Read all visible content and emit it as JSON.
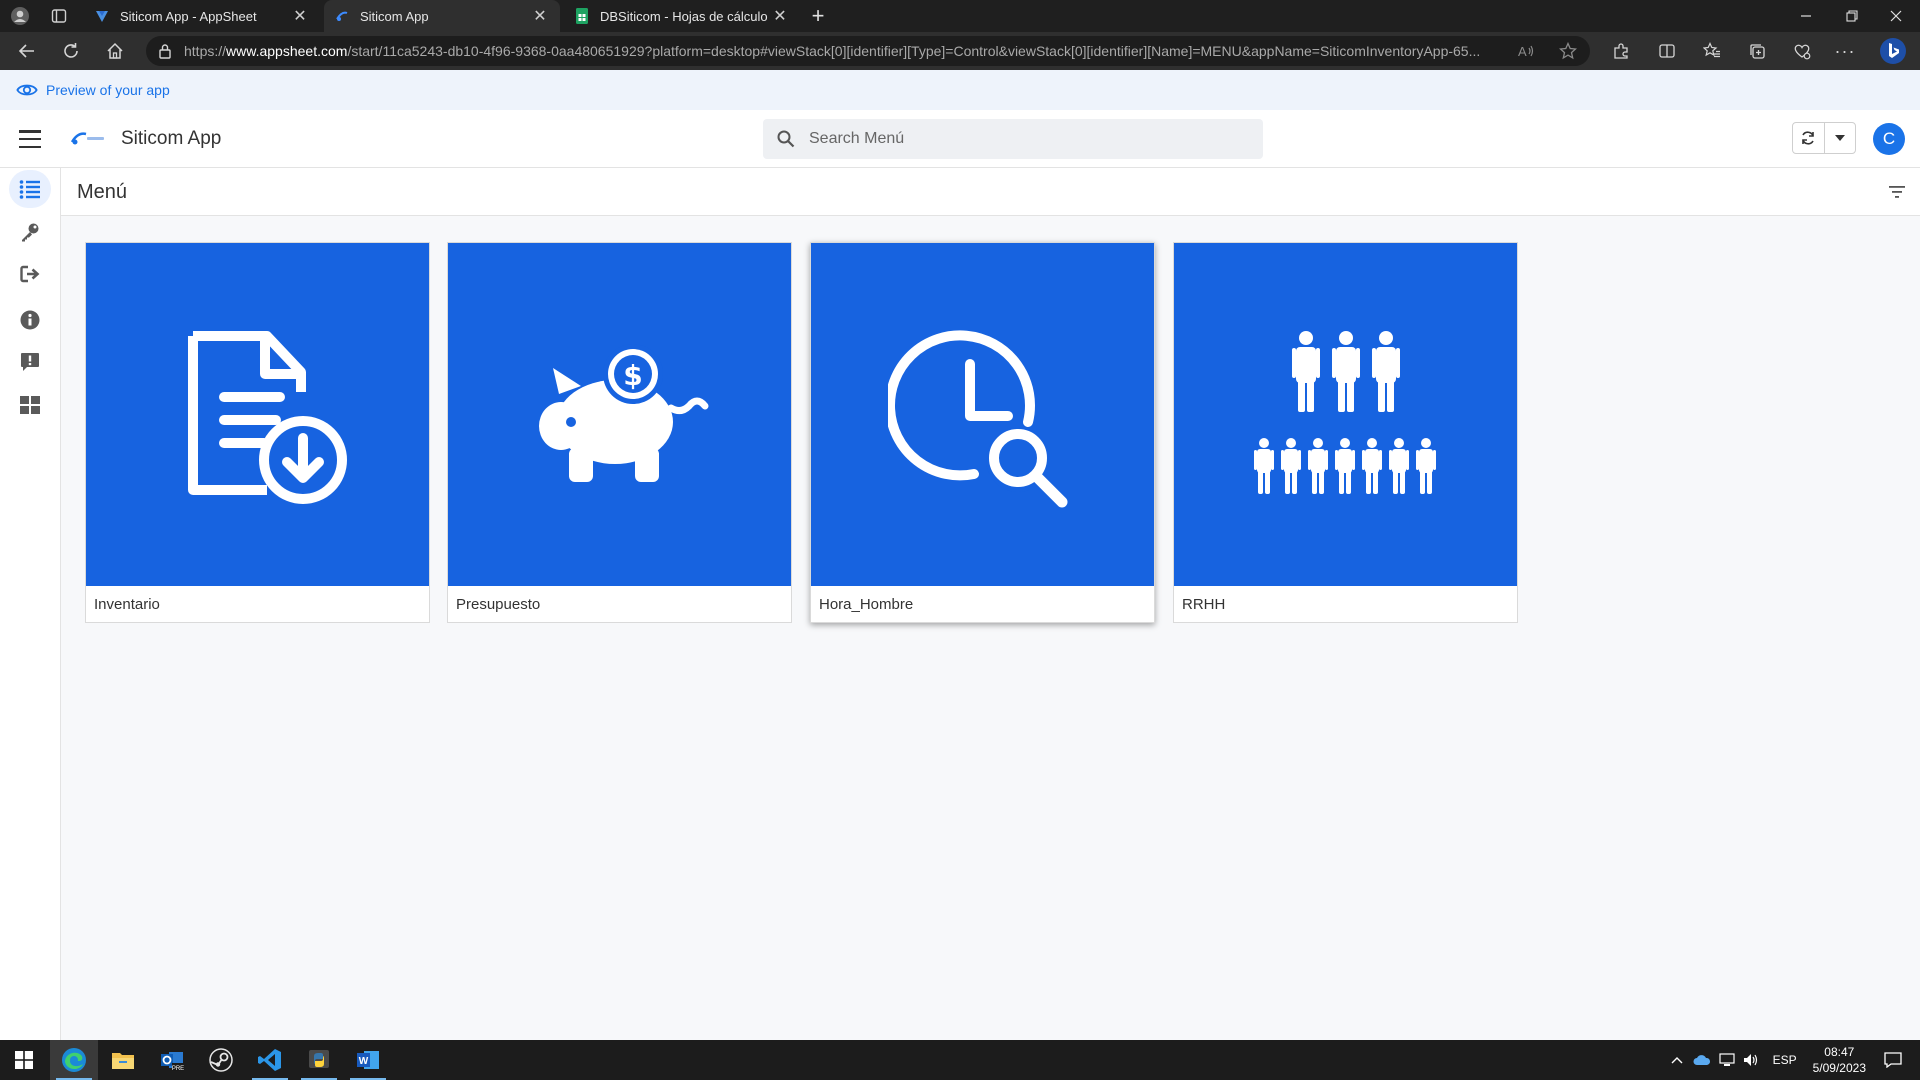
{
  "browser": {
    "tabs": [
      {
        "title": "Siticom App - AppSheet",
        "icon": "appsheet-icon"
      },
      {
        "title": "Siticom App",
        "icon": "siticom-icon"
      },
      {
        "title": "DBSiticom - Hojas de cálculo de",
        "icon": "google-sheets-icon"
      }
    ],
    "url_prefix": "https://",
    "url_domain": "www.appsheet.com",
    "url_rest": "/start/11ca5243-db10-4f96-9368-0aa480651929?platform=desktop#viewStack[0][identifier][Type]=Control&viewStack[0][identifier][Name]=MENU&appName=SiticomInventoryApp-65..."
  },
  "preview_banner": {
    "text": "Preview of your app"
  },
  "header": {
    "app_title": "Siticom App",
    "search_placeholder": "Search Menú",
    "avatar_letter": "C"
  },
  "view": {
    "title": "Menú"
  },
  "sidebar": {
    "items": [
      {
        "icon": "list-icon",
        "active": true
      },
      {
        "icon": "key-icon"
      },
      {
        "icon": "sign-out-icon"
      },
      {
        "icon": "info-icon"
      },
      {
        "icon": "feedback-icon"
      },
      {
        "icon": "grid-icon"
      }
    ]
  },
  "cards": [
    {
      "label": "Inventario",
      "icon": "document-download-icon"
    },
    {
      "label": "Presupuesto",
      "icon": "piggy-bank-icon"
    },
    {
      "label": "Hora_Hombre",
      "icon": "clock-search-icon"
    },
    {
      "label": "RRHH",
      "icon": "people-group-icon"
    }
  ],
  "taskbar": {
    "language": "ESP",
    "time": "08:47",
    "date": "5/09/2023"
  },
  "colors": {
    "accent": "#1a73e8",
    "card_blue": "#1763e0"
  }
}
